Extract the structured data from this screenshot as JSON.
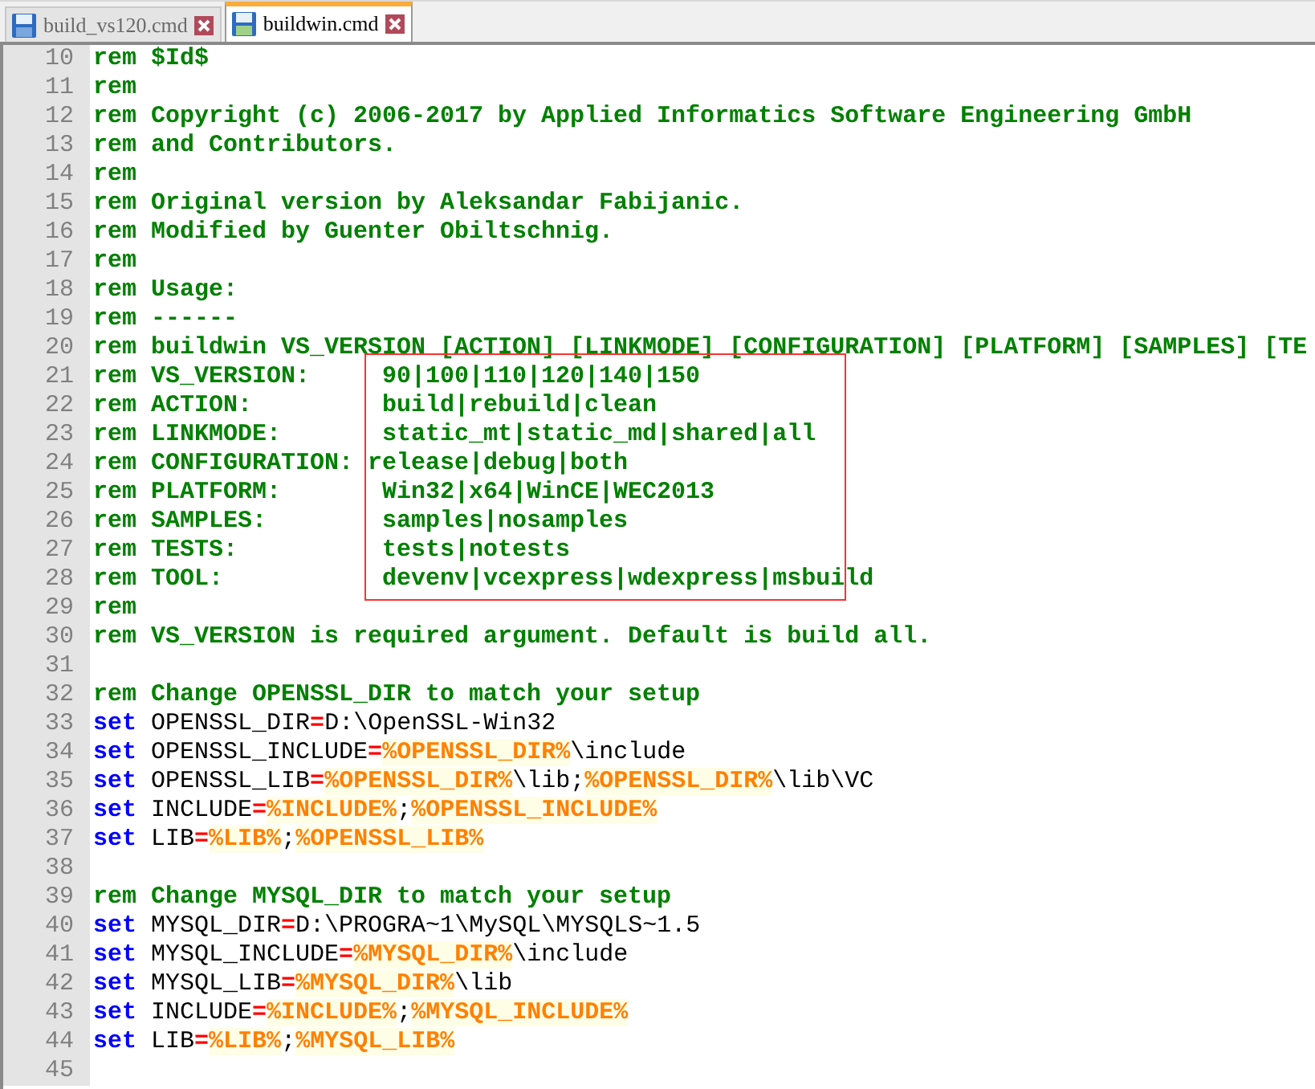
{
  "tabs": [
    {
      "label": "build_vs120.cmd",
      "selected": false
    },
    {
      "label": "buildwin.cmd",
      "selected": true
    }
  ],
  "editor": {
    "groups": [
      {
        "boxed": false,
        "lines": [
          {
            "number": "10",
            "tokens": [
              {
                "kind": "comment",
                "text": "rem $Id$"
              }
            ]
          },
          {
            "number": "11",
            "tokens": [
              {
                "kind": "comment",
                "text": "rem"
              }
            ]
          },
          {
            "number": "12",
            "tokens": [
              {
                "kind": "comment",
                "text": "rem Copyright (c) 2006-2017 by Applied Informatics Software Engineering GmbH"
              }
            ]
          },
          {
            "number": "13",
            "tokens": [
              {
                "kind": "comment",
                "text": "rem and Contributors."
              }
            ]
          },
          {
            "number": "14",
            "tokens": [
              {
                "kind": "comment",
                "text": "rem"
              }
            ]
          },
          {
            "number": "15",
            "tokens": [
              {
                "kind": "comment",
                "text": "rem Original version by Aleksandar Fabijanic."
              }
            ]
          },
          {
            "number": "16",
            "tokens": [
              {
                "kind": "comment",
                "text": "rem Modified by Guenter Obiltschnig."
              }
            ]
          },
          {
            "number": "17",
            "tokens": [
              {
                "kind": "comment",
                "text": "rem"
              }
            ]
          },
          {
            "number": "18",
            "tokens": [
              {
                "kind": "comment",
                "text": "rem Usage:"
              }
            ]
          },
          {
            "number": "19",
            "tokens": [
              {
                "kind": "comment",
                "text": "rem ------"
              }
            ]
          },
          {
            "number": "20",
            "tokens": [
              {
                "kind": "comment",
                "text": "rem buildwin VS_VERSION [ACTION] [LINKMODE] [CONFIGURATION] [PLATFORM] [SAMPLES] [TE"
              }
            ]
          }
        ]
      },
      {
        "boxed": true,
        "lines": [
          {
            "number": "21",
            "tokens": [
              {
                "kind": "comment",
                "text": "rem VS_VERSION:     90|100|110|120|140|150"
              }
            ]
          },
          {
            "number": "22",
            "tokens": [
              {
                "kind": "comment",
                "text": "rem ACTION:         build|rebuild|clean"
              }
            ]
          },
          {
            "number": "23",
            "tokens": [
              {
                "kind": "comment",
                "text": "rem LINKMODE:       static_mt|static_md|shared|all"
              }
            ]
          },
          {
            "number": "24",
            "tokens": [
              {
                "kind": "comment",
                "text": "rem CONFIGURATION: release|debug|both"
              }
            ]
          },
          {
            "number": "25",
            "tokens": [
              {
                "kind": "comment",
                "text": "rem PLATFORM:       Win32|x64|WinCE|WEC2013"
              }
            ]
          },
          {
            "number": "26",
            "tokens": [
              {
                "kind": "comment",
                "text": "rem SAMPLES:        samples|nosamples"
              }
            ]
          },
          {
            "number": "27",
            "tokens": [
              {
                "kind": "comment",
                "text": "rem TESTS:          tests|notests"
              }
            ]
          },
          {
            "number": "28",
            "tokens": [
              {
                "kind": "comment",
                "text": "rem TOOL:           devenv|vcexpress|wdexpress|msbuild"
              }
            ]
          }
        ]
      },
      {
        "boxed": false,
        "lines": [
          {
            "number": "29",
            "tokens": [
              {
                "kind": "comment",
                "text": "rem"
              }
            ]
          },
          {
            "number": "30",
            "tokens": [
              {
                "kind": "comment",
                "text": "rem VS_VERSION is required argument. Default is build all."
              }
            ]
          },
          {
            "number": "31"
          },
          {
            "number": "32",
            "tokens": [
              {
                "kind": "comment",
                "text": "rem Change OPENSSL_DIR to match your setup"
              }
            ]
          },
          {
            "number": "33",
            "tokens": [
              {
                "kind": "keyword",
                "text": "set"
              },
              {
                "kind": "text",
                "text": " OPENSSL_DIR"
              },
              {
                "kind": "operator",
                "text": "="
              },
              {
                "kind": "text",
                "text": "D:\\OpenSSL-Win32"
              }
            ]
          },
          {
            "number": "34",
            "tokens": [
              {
                "kind": "keyword",
                "text": "set"
              },
              {
                "kind": "text",
                "text": " OPENSSL_INCLUDE"
              },
              {
                "kind": "operator",
                "text": "="
              },
              {
                "kind": "variable",
                "text": "%OPENSSL_DIR%"
              },
              {
                "kind": "text",
                "text": "\\include"
              }
            ]
          },
          {
            "number": "35",
            "tokens": [
              {
                "kind": "keyword",
                "text": "set"
              },
              {
                "kind": "text",
                "text": " OPENSSL_LIB"
              },
              {
                "kind": "operator",
                "text": "="
              },
              {
                "kind": "variable",
                "text": "%OPENSSL_DIR%"
              },
              {
                "kind": "text",
                "text": "\\lib;"
              },
              {
                "kind": "variable",
                "text": "%OPENSSL_DIR%"
              },
              {
                "kind": "text",
                "text": "\\lib\\VC"
              }
            ]
          },
          {
            "number": "36",
            "tokens": [
              {
                "kind": "keyword",
                "text": "set"
              },
              {
                "kind": "text",
                "text": " INCLUDE"
              },
              {
                "kind": "operator",
                "text": "="
              },
              {
                "kind": "variable",
                "text": "%INCLUDE%"
              },
              {
                "kind": "text",
                "text": ";"
              },
              {
                "kind": "variable",
                "text": "%OPENSSL_INCLUDE%"
              }
            ]
          },
          {
            "number": "37",
            "tokens": [
              {
                "kind": "keyword",
                "text": "set"
              },
              {
                "kind": "text",
                "text": " LIB"
              },
              {
                "kind": "operator",
                "text": "="
              },
              {
                "kind": "variable",
                "text": "%LIB%"
              },
              {
                "kind": "text",
                "text": ";"
              },
              {
                "kind": "variable",
                "text": "%OPENSSL_LIB%"
              }
            ]
          },
          {
            "number": "38"
          },
          {
            "number": "39",
            "tokens": [
              {
                "kind": "comment",
                "text": "rem Change MYSQL_DIR to match your setup"
              }
            ]
          },
          {
            "number": "40",
            "tokens": [
              {
                "kind": "keyword",
                "text": "set"
              },
              {
                "kind": "text",
                "text": " MYSQL_DIR"
              },
              {
                "kind": "operator",
                "text": "="
              },
              {
                "kind": "text",
                "text": "D:\\PROGRA~1\\MySQL\\MYSQLS~1.5"
              }
            ]
          },
          {
            "number": "41",
            "tokens": [
              {
                "kind": "keyword",
                "text": "set"
              },
              {
                "kind": "text",
                "text": " MYSQL_INCLUDE"
              },
              {
                "kind": "operator",
                "text": "="
              },
              {
                "kind": "variable",
                "text": "%MYSQL_DIR%"
              },
              {
                "kind": "text",
                "text": "\\include"
              }
            ]
          },
          {
            "number": "42",
            "tokens": [
              {
                "kind": "keyword",
                "text": "set"
              },
              {
                "kind": "text",
                "text": " MYSQL_LIB"
              },
              {
                "kind": "operator",
                "text": "="
              },
              {
                "kind": "variable",
                "text": "%MYSQL_DIR%"
              },
              {
                "kind": "text",
                "text": "\\lib"
              }
            ]
          },
          {
            "number": "43",
            "tokens": [
              {
                "kind": "keyword",
                "text": "set"
              },
              {
                "kind": "text",
                "text": " INCLUDE"
              },
              {
                "kind": "operator",
                "text": "="
              },
              {
                "kind": "variable",
                "text": "%INCLUDE%"
              },
              {
                "kind": "text",
                "text": ";"
              },
              {
                "kind": "variable",
                "text": "%MYSQL_INCLUDE%"
              }
            ]
          },
          {
            "number": "44",
            "tokens": [
              {
                "kind": "keyword",
                "text": "set"
              },
              {
                "kind": "text",
                "text": " LIB"
              },
              {
                "kind": "operator",
                "text": "="
              },
              {
                "kind": "variable",
                "text": "%LIB%"
              },
              {
                "kind": "text",
                "text": ";"
              },
              {
                "kind": "variable",
                "text": "%MYSQL_LIB%"
              }
            ]
          },
          {
            "number": "45"
          }
        ]
      }
    ]
  }
}
